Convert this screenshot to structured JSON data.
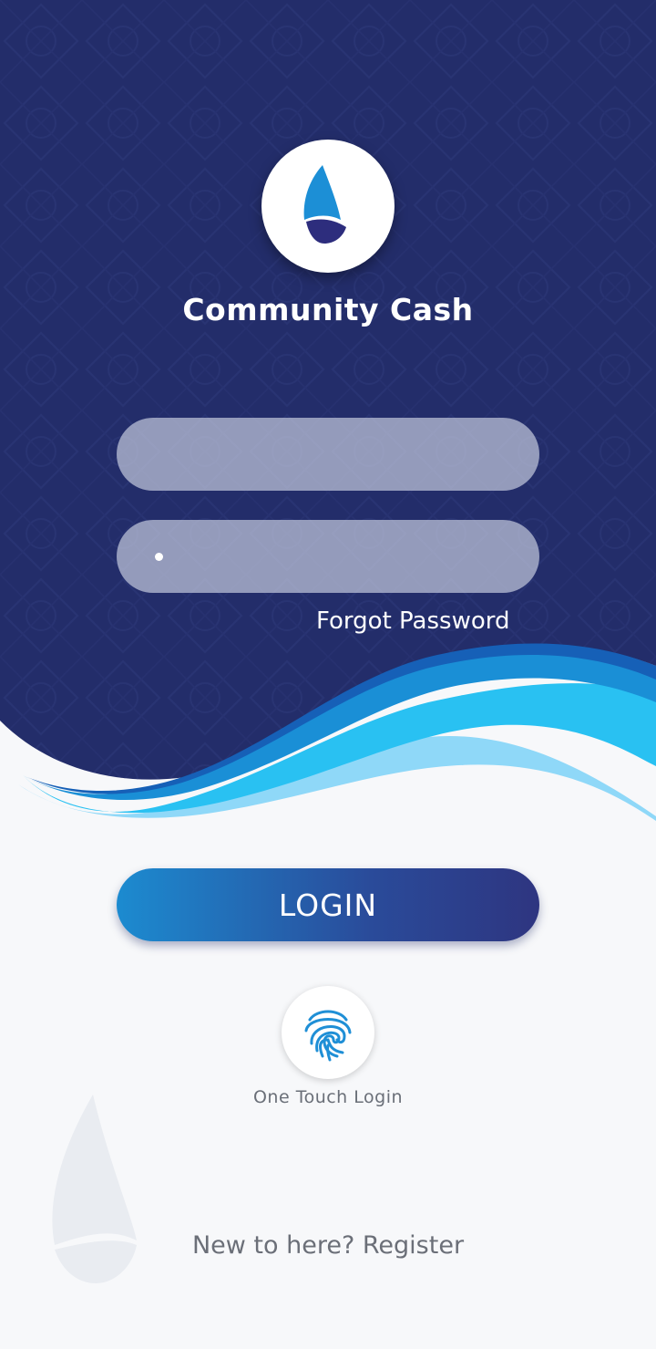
{
  "app": {
    "title": "Community Cash"
  },
  "form": {
    "username_value": "",
    "password_value": "•",
    "forgot_label": "Forgot Password"
  },
  "actions": {
    "login_label": "LOGIN",
    "one_touch_label": "One Touch Login"
  },
  "footer": {
    "prompt": "New to here?",
    "register_label": "Register"
  },
  "icons": {
    "logo": "sail-logo-icon",
    "fingerprint": "fingerprint-icon"
  },
  "colors": {
    "navy": "#26306e",
    "wave_light": "#29c1f2",
    "wave_mid": "#1a8fd6",
    "wave_dark": "#1660b7",
    "button_start": "#1c8bd0",
    "button_end": "#2e3580"
  }
}
